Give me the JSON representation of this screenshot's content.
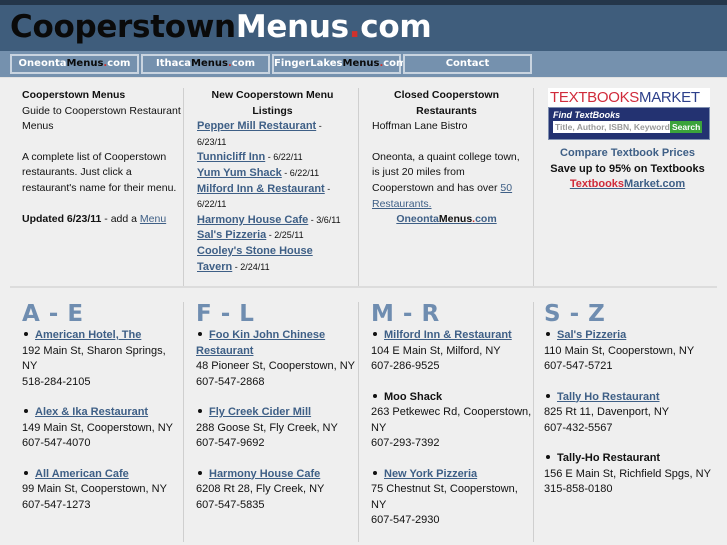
{
  "header": {
    "logo_part1": "Cooperstown",
    "logo_part2": "Menus",
    "logo_dot": ".",
    "logo_part3": "com"
  },
  "nav": [
    {
      "p1": "Oneonta",
      "p2": "Menus",
      "p3": ".",
      "p4": "com"
    },
    {
      "p1": "Ithaca",
      "p2": "Menus",
      "p3": ".",
      "p4": "com"
    },
    {
      "p1": "FingerLakes",
      "p2": "Menus",
      "p3": ".",
      "p4": "com"
    },
    {
      "label": "Contact"
    }
  ],
  "intro": {
    "title": "Cooperstown Menus",
    "subtitle": "Guide to Cooperstown Restaurant Menus",
    "description": "A complete list of Cooperstown restaurants. Just click a restaurant's name for their menu.",
    "updated": "Updated 6/23/11",
    "add_text": " - add a ",
    "add_link": "Menu"
  },
  "new_listings": {
    "title": "New Cooperstown Menu Listings",
    "items": [
      {
        "name": "Pepper Mill Restaurant",
        "date": " - 6/23/11"
      },
      {
        "name": "Tunnicliff Inn",
        "date": " - 6/22/11"
      },
      {
        "name": "Yum Yum Shack",
        "date": " - 6/22/11"
      },
      {
        "name": "Milford Inn & Restaurant",
        "date": " - 6/22/11"
      },
      {
        "name": "Harmony House Cafe",
        "date": " - 3/6/11"
      },
      {
        "name": "Sal's Pizzeria",
        "date": " - 2/25/11"
      },
      {
        "name": "Cooley's Stone House Tavern",
        "date": " - 2/24/11"
      }
    ]
  },
  "closed": {
    "title": "Closed Cooperstown Restaurants",
    "items": [
      "Hoffman Lane Bistro"
    ],
    "oneonta_text": "Oneonta, a quaint college town, is just 20 miles from Cooperstown and has over ",
    "oneonta_link": "50 Restaurants.",
    "oneonta_site": {
      "p1": "Oneonta",
      "p2": "Menus",
      "p3": ".",
      "p4": "com"
    }
  },
  "ad": {
    "logo_red": "TEXTBOOKS",
    "logo_blue": "MARKET",
    "find_label": "Find TextBooks",
    "search_placeholder": "Title, Author, ISBN, Keyword",
    "search_button": "Search",
    "compare": "Compare Textbook Prices",
    "save": "Save up to 95% on Textbooks",
    "site_red": "Textbooks",
    "site_blue": "Market.com"
  },
  "directory": [
    {
      "letter": "A - E",
      "entries": [
        {
          "name": "American Hotel, The",
          "linked": true,
          "address": "192 Main St, Sharon Springs, NY",
          "phone": "518-284-2105"
        },
        {
          "name": "Alex & Ika Restaurant",
          "linked": true,
          "address": "149 Main St, Cooperstown, NY",
          "phone": "607-547-4070"
        },
        {
          "name": "All American Cafe",
          "linked": true,
          "address": "99 Main St, Cooperstown, NY",
          "phone": "607-547-1273"
        }
      ]
    },
    {
      "letter": "F - L",
      "entries": [
        {
          "name": "Foo Kin John Chinese Restaurant",
          "linked": true,
          "address": "48 Pioneer St, Cooperstown, NY",
          "phone": "607-547-2868"
        },
        {
          "name": "Fly Creek Cider Mill",
          "linked": true,
          "address": "288 Goose St, Fly Creek, NY",
          "phone": "607-547-9692"
        },
        {
          "name": "Harmony House Cafe",
          "linked": true,
          "address": "6208 Rt 28, Fly Creek, NY",
          "phone": "607-547-5835"
        }
      ]
    },
    {
      "letter": "M - R",
      "entries": [
        {
          "name": "Milford Inn & Restaurant",
          "linked": true,
          "address": "104 E Main St, Milford, NY",
          "phone": "607-286-9525"
        },
        {
          "name": "Moo Shack",
          "linked": false,
          "address": "263 Petkewec Rd, Cooperstown, NY",
          "phone": "607-293-7392"
        },
        {
          "name": "New York Pizzeria",
          "linked": true,
          "address": "75 Chestnut St, Cooperstown, NY",
          "phone": "607-547-2930"
        }
      ]
    },
    {
      "letter": "S - Z",
      "entries": [
        {
          "name": "Sal's Pizzeria",
          "linked": true,
          "address": "110 Main St, Cooperstown, NY",
          "phone": "607-547-5721"
        },
        {
          "name": "Tally Ho Restaurant",
          "linked": true,
          "address": "825 Rt 11, Davenport, NY",
          "phone": "607-432-5567"
        },
        {
          "name": "Tally-Ho Restaurant",
          "linked": false,
          "address": "156 E Main St, Richfield Spgs, NY",
          "phone": "315-858-0180"
        }
      ]
    }
  ]
}
